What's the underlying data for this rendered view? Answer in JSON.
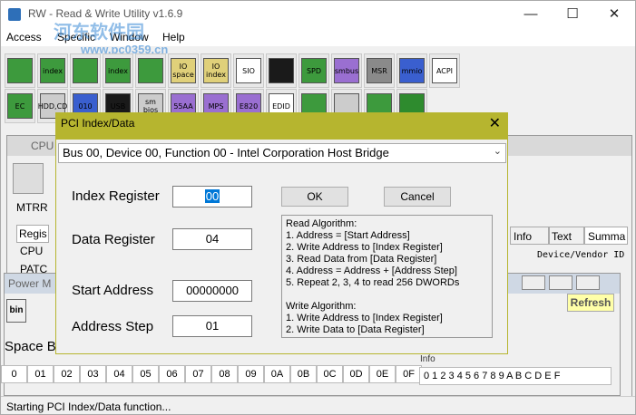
{
  "window": {
    "title": "RW - Read & Write Utility v1.6.9",
    "watermark": "河东软件园",
    "watermark_url": "www.pc0359.cn",
    "min": "—",
    "max": "☐",
    "close": "✕"
  },
  "menu": [
    "Access",
    "Specific",
    "Window",
    "Help"
  ],
  "toolbar1": [
    {
      "label": "",
      "icon": "pci-card-icon",
      "color": "#3d9a3d"
    },
    {
      "label": "index",
      "icon": "index-card-icon",
      "color": "#3d9a3d"
    },
    {
      "label": "",
      "icon": "memory-icon",
      "color": "#3d9a3d"
    },
    {
      "label": "index",
      "icon": "index-memory-icon",
      "color": "#3d9a3d"
    },
    {
      "label": "",
      "icon": "io-card-icon",
      "color": "#3d9a3d"
    },
    {
      "label": "IO space",
      "icon": "io-space-icon",
      "color": "#e0d07a"
    },
    {
      "label": "IO index",
      "icon": "io-index-icon",
      "color": "#e0d07a"
    },
    {
      "label": "SIO",
      "icon": "sio-icon",
      "color": "#ffffff"
    },
    {
      "label": "",
      "icon": "oscilloscope-icon",
      "color": "#1a1a1a"
    },
    {
      "label": "SPD",
      "icon": "spd-icon",
      "color": "#3d9a3d"
    },
    {
      "label": "smbus",
      "icon": "smbus-icon",
      "color": "#9a6fd1"
    },
    {
      "label": "MSR",
      "icon": "msr-cpu-icon",
      "color": "#8a8a8a"
    },
    {
      "label": "mmio",
      "icon": "mmio-icon",
      "color": "#3a5fcf"
    },
    {
      "label": "ACPI",
      "icon": "acpi-icon",
      "color": "#ffffff"
    }
  ],
  "toolbar2": [
    {
      "label": "EC",
      "icon": "ec-icon",
      "color": "#3d9a3d"
    },
    {
      "label": "HDD,CD",
      "icon": "hdd-cd-icon",
      "color": "#cccccc"
    },
    {
      "label": "010",
      "icon": "binary-icon",
      "color": "#3a5fcf"
    },
    {
      "label": "USB",
      "icon": "usb-icon",
      "color": "#1a1a1a"
    },
    {
      "label": "sm bios",
      "icon": "smbios-icon",
      "color": "#cccccc"
    },
    {
      "label": "55AA",
      "icon": "55aa-icon",
      "color": "#9a6fd1"
    },
    {
      "label": "MPS",
      "icon": "mps-icon",
      "color": "#9a6fd1"
    },
    {
      "label": "E820",
      "icon": "e820-icon",
      "color": "#9a6fd1"
    },
    {
      "label": "EDID",
      "icon": "edid-icon",
      "color": "#ffffff"
    },
    {
      "label": "",
      "icon": "monitor-icon",
      "color": "#3d9a3d"
    },
    {
      "label": "",
      "icon": "chip-icon",
      "color": "#cccccc"
    },
    {
      "label": "",
      "icon": "grid-icon",
      "color": "#3d9a3d"
    },
    {
      "label": "",
      "icon": "help-icon",
      "color": "#2e8b2e"
    }
  ],
  "bg": {
    "cpu_title": "CPU",
    "mtrr": "MTRR",
    "regis": "Regis",
    "cpu": "CPU",
    "patc": "PATC",
    "power_title": "Power M",
    "tabs": [
      "Info",
      "Text",
      "Summa"
    ],
    "device_vendor": "Device/Vendor ID",
    "refresh": "Refresh",
    "bin": "bin",
    "space_label": "Space Ba",
    "hex_cells": [
      "0",
      "01",
      "02",
      "03",
      "04",
      "05",
      "06",
      "07",
      "08",
      "09",
      "0A",
      "0B",
      "0C",
      "0D",
      "0E",
      "0F"
    ],
    "hex_ascii": "0 1 2 3 4 5 6 7 8 9 A B C D E F",
    "info_tab": "Info"
  },
  "status": "Starting PCI Index/Data function...",
  "dialog": {
    "title": "PCI Index/Data",
    "close": "✕",
    "device": "Bus 00, Device 00, Function 00 - Intel Corporation Host Bridge",
    "index_label": "Index Register",
    "index_value": "00",
    "data_label": "Data Register",
    "data_value": "04",
    "start_label": "Start Address",
    "start_value": "00000000",
    "step_label": "Address Step",
    "step_value": "01",
    "ok": "OK",
    "cancel": "Cancel",
    "algorithm": [
      "Read Algorithm:",
      "1. Address = [Start Address]",
      "2. Write Address to [Index Register]",
      "3. Read Data from [Data Register]",
      "4. Address = Address + [Address Step]",
      "5. Repeat 2, 3, 4 to read 256 DWORDs",
      "",
      "Write Algorithm:",
      "1. Write Address to [Index Register]",
      "2. Write Data to [Data Register]"
    ]
  }
}
